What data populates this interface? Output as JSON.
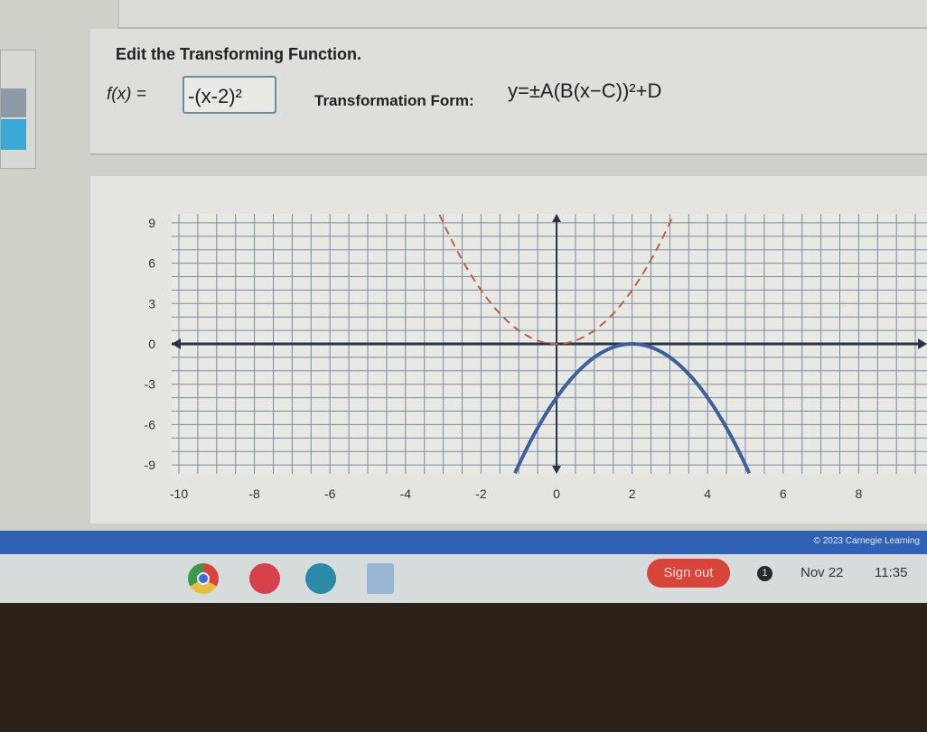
{
  "header": {
    "title": "Edit the Transforming Function.",
    "fx_label": "f(x) =",
    "fx_value": "-(x-2)²",
    "form_label": "Transformation Form:",
    "form_expr": "y=±A(B(x−C))²+D"
  },
  "chart_data": {
    "type": "line",
    "xlim": [
      -10,
      10
    ],
    "ylim": [
      -9.7,
      9.7
    ],
    "x_ticks": [
      "-10",
      "-8",
      "-6",
      "-4",
      "-2",
      "0",
      "2",
      "4",
      "6",
      "8"
    ],
    "y_ticks": [
      "9",
      "6",
      "3",
      "0",
      "-3",
      "-6",
      "-9"
    ],
    "grid": true,
    "series": [
      {
        "expression": "x^2",
        "style": "dashed",
        "color": "#c0604a"
      },
      {
        "expression": "-(x-2)^2",
        "style": "solid",
        "color": "#3d5f9e"
      }
    ]
  },
  "footer": {
    "copyright": "© 2023 Carnegie Learning"
  },
  "taskbar": {
    "sign_out": "Sign out",
    "notifications": "1",
    "date": "Nov 22",
    "time": "11:35"
  }
}
